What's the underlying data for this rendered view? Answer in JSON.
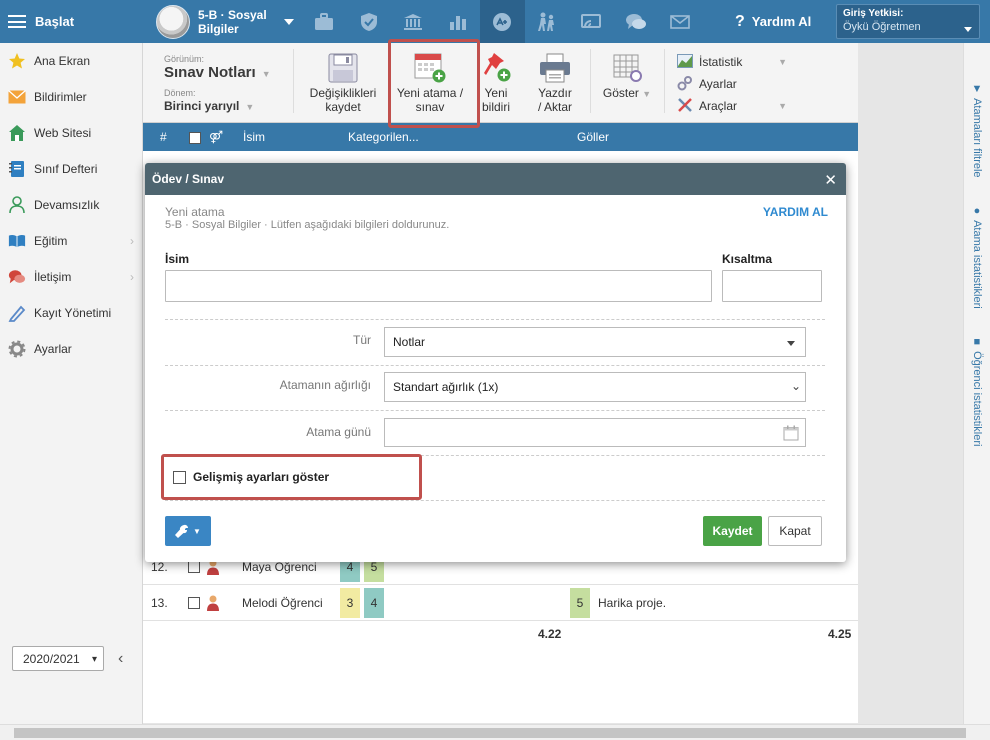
{
  "topbar": {
    "menu_label": "Başlat",
    "class_name": "5-B · Sosyal Bilgiler",
    "help_label": "Yardım Al",
    "auth_label": "Giriş Yetkisi:",
    "auth_value": "Öykü Öğretmen",
    "icons": [
      "briefcase-icon",
      "shield-icon",
      "institution-icon",
      "bar-chart-icon",
      "grades-icon",
      "students-icon",
      "screen-share-icon",
      "chat-icon",
      "mail-icon"
    ]
  },
  "sidebar": {
    "items": [
      {
        "label": "Ana Ekran",
        "icon": "star-icon"
      },
      {
        "label": "Bildirimler",
        "icon": "envelope-icon"
      },
      {
        "label": "Web Sitesi",
        "icon": "home-icon"
      },
      {
        "label": "Sınıf Defteri",
        "icon": "notebook-icon"
      },
      {
        "label": "Devamsızlık",
        "icon": "person-icon"
      },
      {
        "label": "Eğitim",
        "icon": "book-icon"
      },
      {
        "label": "İletişim",
        "icon": "chat-icon"
      },
      {
        "label": "Kayıt Yönetimi",
        "icon": "pen-icon"
      },
      {
        "label": "Ayarlar",
        "icon": "gear-icon"
      }
    ],
    "year": "2020/2021"
  },
  "toolbar": {
    "view_label": "Görünüm:",
    "view_value": "Sınav Notları",
    "term_label": "Dönem:",
    "term_value": "Birinci yarıyıl",
    "save_changes": "Değişiklikleri kaydet",
    "new_assignment": "Yeni atama / sınav",
    "new_notice": "Yeni bildiri",
    "print_export": "Yazdır / Aktar",
    "show": "Göster",
    "statistics": "İstatistik",
    "settings": "Ayarlar",
    "tools": "Araçlar"
  },
  "table": {
    "headers": {
      "num": "#",
      "name": "İsim",
      "categorized": "Kategorilen...",
      "goals": "Göller"
    },
    "rows": [
      {
        "num": "12.",
        "name": "Maya Öğrenci",
        "grades": [
          "4",
          "5"
        ],
        "goal": "",
        "comment": ""
      },
      {
        "num": "13.",
        "name": "Melodi Öğrenci",
        "grades": [
          "3",
          "4"
        ],
        "goal": "5",
        "comment": "Harika proje."
      }
    ],
    "avg_left": "4.22",
    "avg_right": "4.25"
  },
  "right_panel": {
    "filter": "Atamaları filtrele",
    "assign_stats": "Atama istatistikleri",
    "student_stats": "Öğrenci istatistikleri"
  },
  "modal": {
    "title": "Ödev / Sınav",
    "subtitle": "Yeni atama",
    "description": "5-B · Sosyal Bilgiler · Lütfen aşağıdaki bilgileri doldurunuz.",
    "help": "YARDIM AL",
    "name_label": "İsim",
    "name_value": "",
    "abbr_label": "Kısaltma",
    "abbr_value": "",
    "type_label": "Tür",
    "type_value": "Notlar",
    "weight_label": "Atamanın ağırlığı",
    "weight_value": "Standart ağırlık (1x)",
    "date_label": "Atama günü",
    "date_value": "",
    "advanced_label": "Gelişmiş ayarları göster",
    "save_label": "Kaydet",
    "close_label": "Kapat"
  }
}
